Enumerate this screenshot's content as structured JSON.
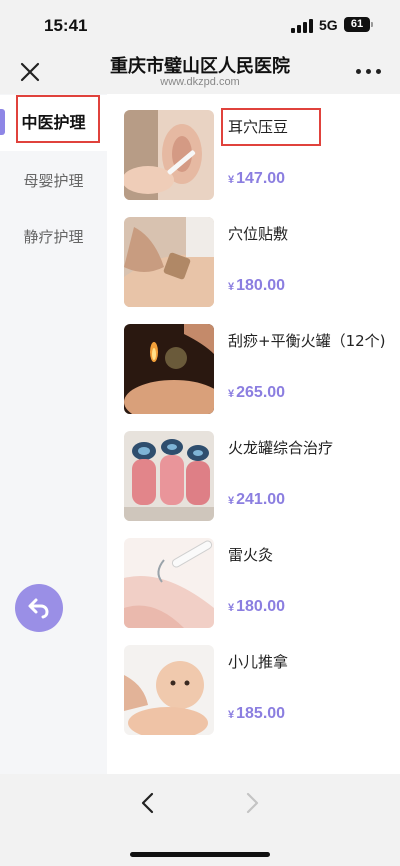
{
  "status": {
    "time": "15:41",
    "network": "5G",
    "battery": "61"
  },
  "header": {
    "title": "重庆市璧山区人民医院",
    "subtitle": "www.dkzpd.com"
  },
  "sidebar": {
    "items": [
      {
        "label": "中医护理",
        "active": true
      },
      {
        "label": "母婴护理",
        "active": false
      },
      {
        "label": "静疗护理",
        "active": false
      }
    ]
  },
  "products": [
    {
      "name": "耳穴压豆",
      "currency": "¥",
      "price": "147.00"
    },
    {
      "name": "穴位贴敷",
      "currency": "¥",
      "price": "180.00"
    },
    {
      "name": "刮痧+平衡火罐（12个)",
      "currency": "¥",
      "price": "265.00"
    },
    {
      "name": "火龙罐综合治疗",
      "currency": "¥",
      "price": "241.00"
    },
    {
      "name": "雷火灸",
      "currency": "¥",
      "price": "180.00"
    },
    {
      "name": "小儿推拿",
      "currency": "¥",
      "price": "185.00"
    }
  ],
  "colors": {
    "accent": "#8b7ee0",
    "highlight": "#e0423c",
    "sidebar_bg": "#f5f6f8"
  }
}
